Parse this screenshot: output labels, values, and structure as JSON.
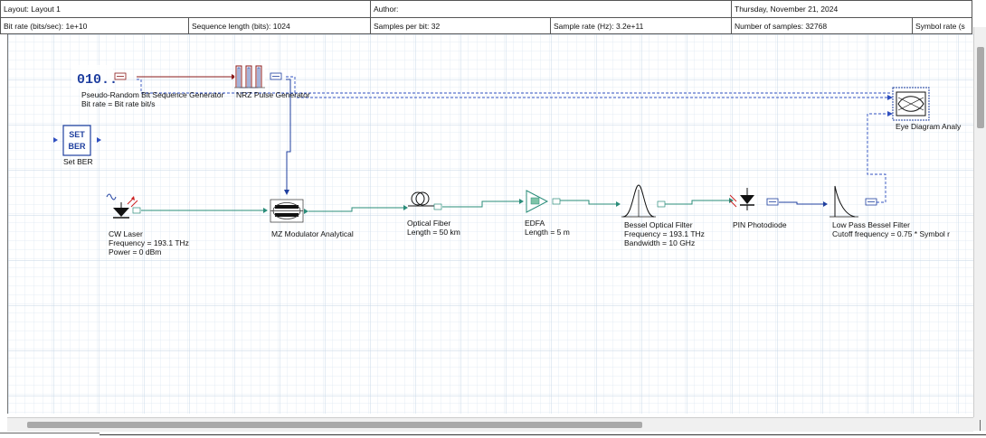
{
  "header": {
    "layout": "Layout: Layout 1",
    "author": "Author:",
    "date": "Thursday, November 21, 2024",
    "bit_rate": "Bit rate (bits/sec):  1e+10",
    "sequence_length": "Sequence length (bits):  1024",
    "samples_per_bit": "Samples per bit:  32",
    "sample_rate": "Sample rate (Hz):  3.2e+11",
    "number_of_samples": "Number of samples:  32768",
    "symbol_rate": "Symbol rate (s"
  },
  "components": {
    "prbs": {
      "name": "Pseudo-Random Bit Sequence Generator",
      "param1": "Bit rate = Bit rate  bit/s",
      "glyph": "010.."
    },
    "nrz": {
      "name": "NRZ Pulse Generator"
    },
    "set_ber": {
      "name": "Set BER",
      "line1": "SET",
      "line2": "BER"
    },
    "cw_laser": {
      "name": "CW Laser",
      "param1": "Frequency = 193.1  THz",
      "param2": "Power = 0  dBm"
    },
    "mz_modulator": {
      "name": "MZ Modulator Analytical"
    },
    "optical_fiber": {
      "name": "Optical Fiber",
      "param1": "Length = 50  km"
    },
    "edfa": {
      "name": "EDFA",
      "param1": "Length = 5  m"
    },
    "bessel_optical_filter": {
      "name": "Bessel Optical Filter",
      "param1": "Frequency = 193.1  THz",
      "param2": "Bandwidth = 10  GHz"
    },
    "pin_photodiode": {
      "name": "PIN Photodiode"
    },
    "low_pass_filter": {
      "name": "Low Pass Bessel Filter",
      "param1": "Cutoff frequency = 0.75 * Symbol r"
    },
    "eye_diagram": {
      "name": "Eye Diagram Analy"
    }
  },
  "colors": {
    "optical_link": "#2a8c7a",
    "electrical_link": "#1f3f9f",
    "binary_link": "#8b1a1a",
    "dashed_link": "#3050c0",
    "grid": "#dde8f2"
  }
}
